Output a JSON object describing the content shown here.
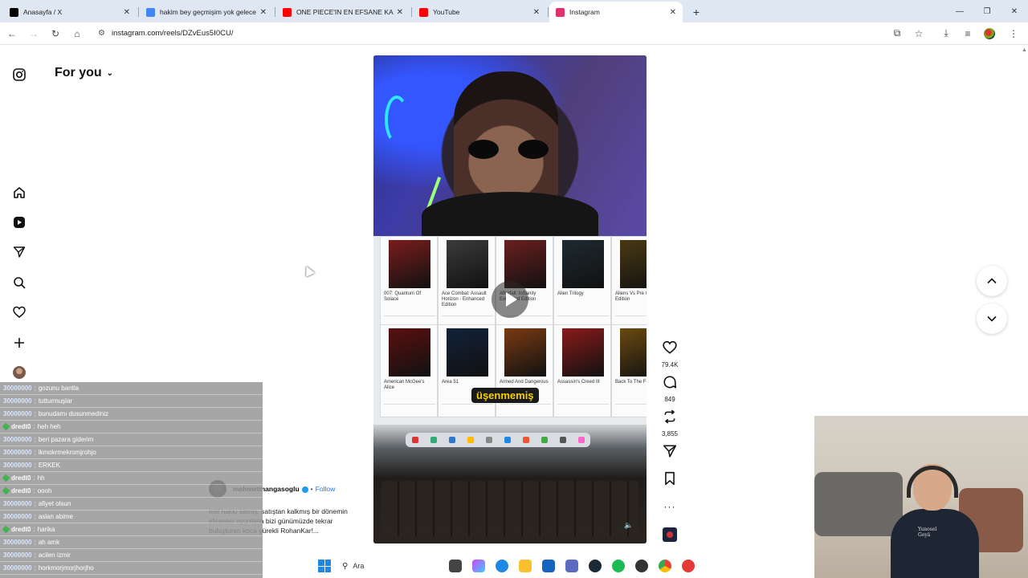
{
  "browser": {
    "tabs": [
      {
        "title": "Anasayfa / X",
        "favicon": "x-logo-icon",
        "active": false,
        "color": "#000000"
      },
      {
        "title": "hakim bey geçmişim yok gelece",
        "favicon": "google-icon",
        "active": false,
        "color": "#4285f4"
      },
      {
        "title": "ONE PIECE'IN EN EFSANE KARA",
        "favicon": "youtube-icon",
        "active": false,
        "color": "#ff0000"
      },
      {
        "title": "YouTube",
        "favicon": "youtube-icon",
        "active": false,
        "color": "#ff0000"
      },
      {
        "title": "Instagram",
        "favicon": "instagram-icon",
        "active": true,
        "color": "#e1306c"
      }
    ],
    "url": "instagram.com/reels/DZvEus5I0CU/"
  },
  "header": {
    "title": "For you"
  },
  "reel": {
    "caption_overlay": "üşenmemiş",
    "actions": {
      "likes": "79.4K",
      "comments": "849",
      "reposts": "3,855"
    },
    "author": {
      "username": "mehmetmangasoglu",
      "follow_label": "Follow",
      "separator": "•"
    },
    "description": "telif hakkı bitmiş, satıştan kalkmış bir dönemin efsanesi oyunlarla bizi günümüzde tekrar buluşturan koca yürekli RohanKar!...",
    "game_cards": [
      {
        "title": "007: Quantum Of Solace",
        "color": "#7a1c1c"
      },
      {
        "title": "Ace Combat: Assault Horizon - Enhanced Edition",
        "color": "#3b3b3b"
      },
      {
        "title": "Afterfall: InSanity Extended Edition",
        "color": "#6b1f1f"
      },
      {
        "title": "Alien Trilogy",
        "color": "#1e2a30"
      },
      {
        "title": "Aliens Vs Pre Gold Edition",
        "color": "#4a3a12"
      },
      {
        "title": "American McGee's Alice",
        "color": "#5a1010"
      },
      {
        "title": "Area 51",
        "color": "#12223a"
      },
      {
        "title": "Armed And Dangerous",
        "color": "#7a3a12"
      },
      {
        "title": "Assassin's Creed III",
        "color": "#8a1a1a"
      },
      {
        "title": "Back To The Fu Game",
        "color": "#6a4a10"
      }
    ]
  },
  "chat": {
    "messages": [
      {
        "user": "30000000",
        "text": "gozunu bantla",
        "gem": false
      },
      {
        "user": "30000000",
        "text": "tutturmuşlar",
        "gem": false
      },
      {
        "user": "30000000",
        "text": "bunudamı dusunmediniz",
        "gem": false
      },
      {
        "user": "dredt0",
        "text": "heh heh",
        "gem": true
      },
      {
        "user": "30000000",
        "text": "beri pazara giderim",
        "gem": false
      },
      {
        "user": "30000000",
        "text": "lkmokrmekromjrohjo",
        "gem": false
      },
      {
        "user": "30000000",
        "text": "ERKEK",
        "gem": false
      },
      {
        "user": "dredt0",
        "text": "hh",
        "gem": true
      },
      {
        "user": "dredt0",
        "text": "oooh",
        "gem": true
      },
      {
        "user": "30000000",
        "text": "afiyet olsun",
        "gem": false
      },
      {
        "user": "30000000",
        "text": "aslan abime",
        "gem": false
      },
      {
        "user": "dredt0",
        "text": "harika",
        "gem": true
      },
      {
        "user": "30000000",
        "text": "ah amk",
        "gem": false
      },
      {
        "user": "30000000",
        "text": "acilen izmir",
        "gem": false
      },
      {
        "user": "30000000",
        "text": "horkmorjmorjhorjho",
        "gem": false
      }
    ]
  },
  "webcam": {
    "shirt_text": "Yunosel\nGoyä"
  },
  "taskbar": {
    "search_placeholder": "Ara"
  }
}
